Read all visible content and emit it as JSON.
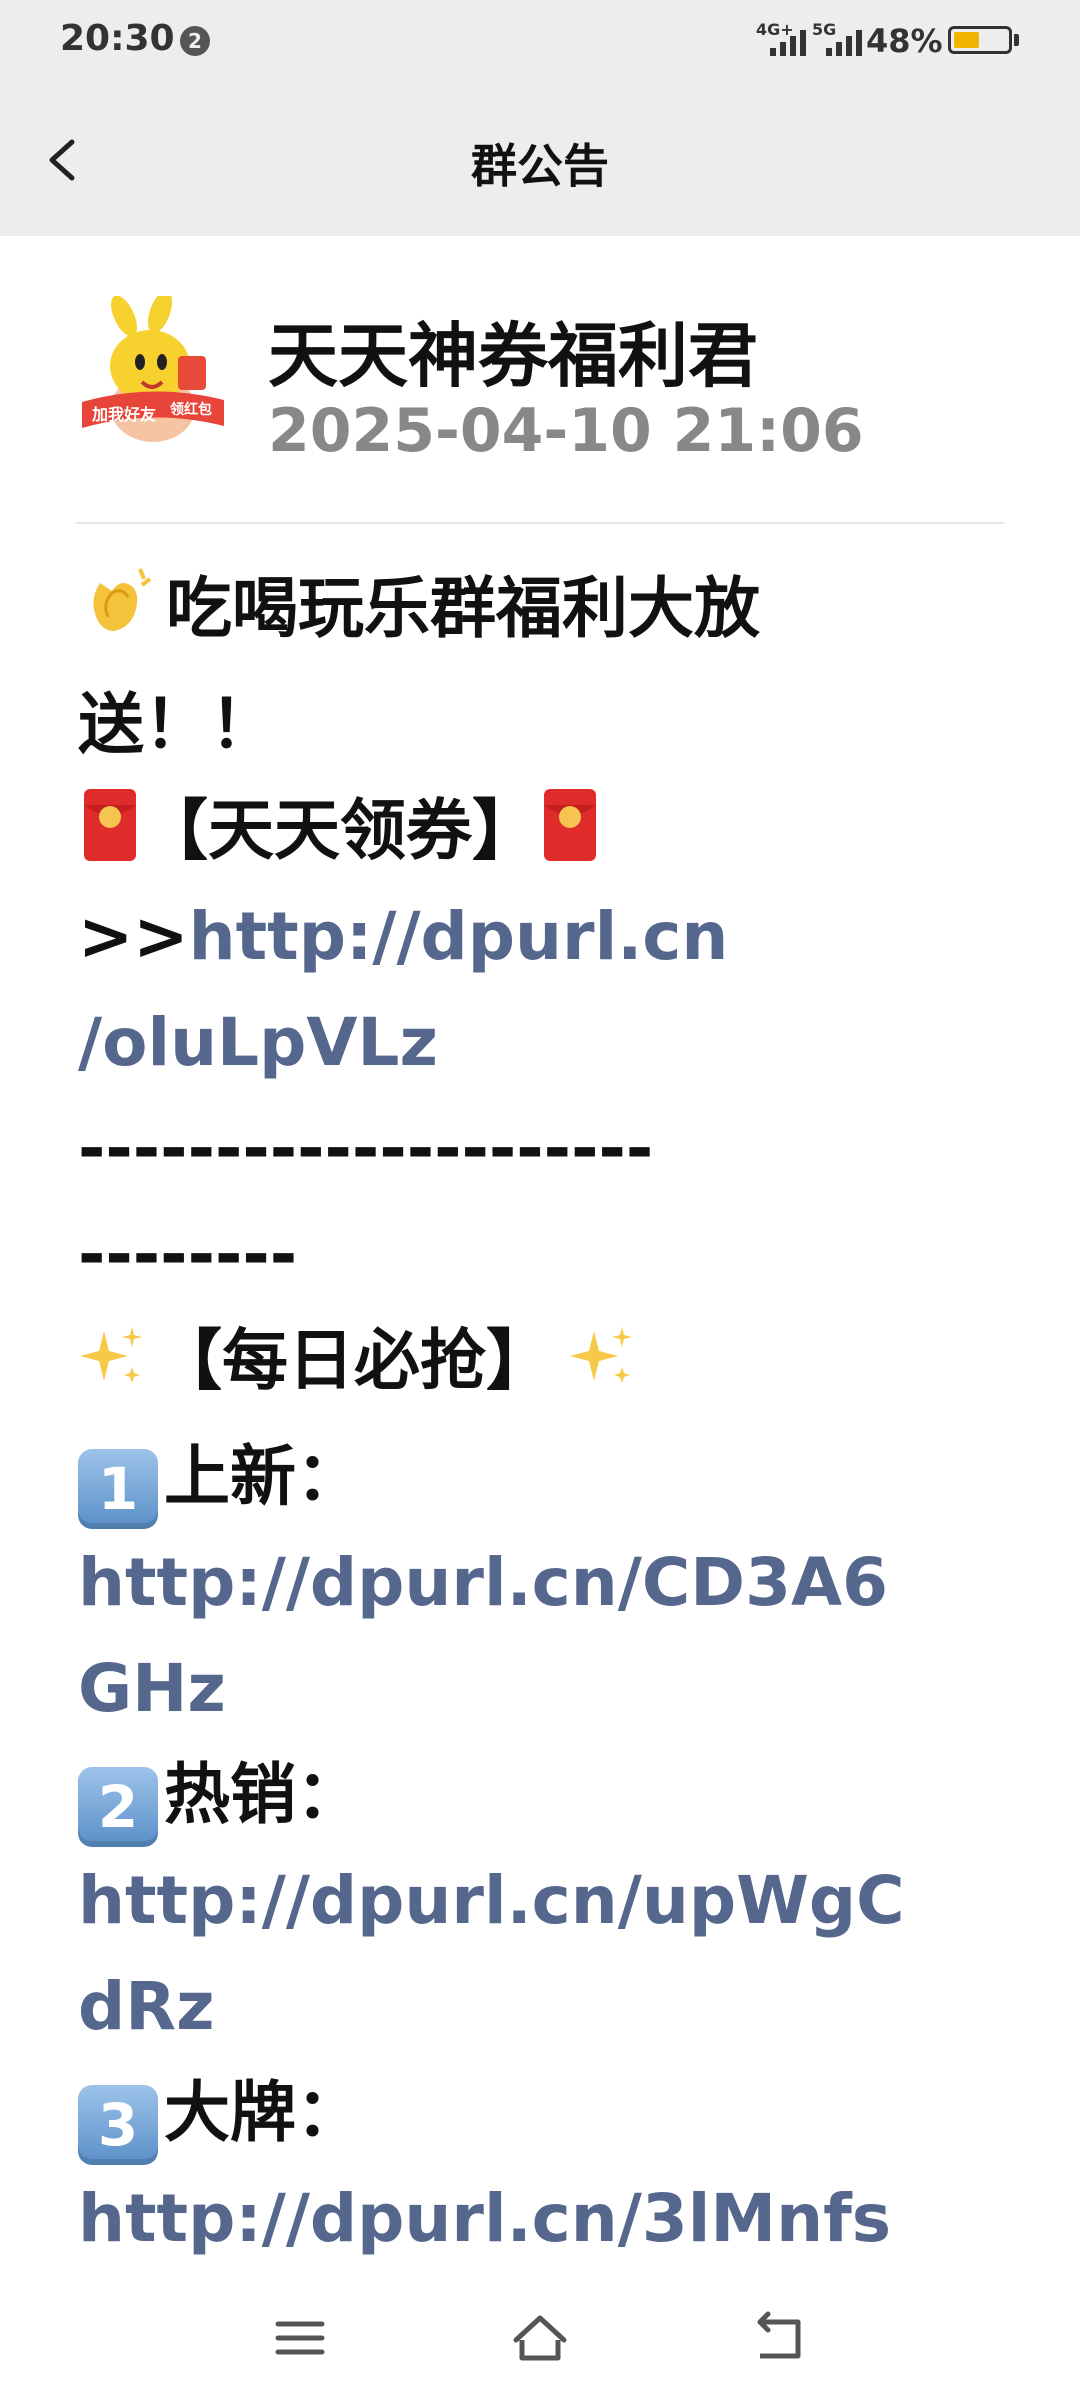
{
  "status_bar": {
    "time": "20:30",
    "notification_count": "2",
    "signal_1_label": "4G+",
    "signal_2_label": "5G",
    "battery_percent": "48%",
    "battery_level": 0.48,
    "battery_color": "#f2b400"
  },
  "navbar": {
    "back_icon": "chevron-left-icon",
    "title": "群公告"
  },
  "announcement": {
    "avatar_icon": "yellow-mascot-avatar",
    "author": "天天神券福利君",
    "timestamp": "2025-04-10 21:06",
    "lines": {
      "headline_1": "吃喝玩乐群福利大放",
      "headline_2": "送！！",
      "coupon_heading": "【天天领券】",
      "coupon_prefix": ">>",
      "coupon_link_1": "http://dpurl.cn",
      "coupon_link_2": "/oluLpVLz",
      "separator_1": "---------------------",
      "separator_2": "--------",
      "daily_heading": "【每日必抢】",
      "item1_num": "1",
      "item1_label": "上新：",
      "item1_link_1": "http://dpurl.cn/CD3A6",
      "item1_link_2": "GHz",
      "item2_num": "2",
      "item2_label": "热销：",
      "item2_link_1": "http://dpurl.cn/upWgC",
      "item2_link_2": "dRz",
      "item3_num": "3",
      "item3_label": "大牌：",
      "item3_link_1": "http://dpurl.cn/3lMnfs"
    },
    "link_color": "#56678e"
  },
  "bottom_nav": {
    "menu_icon": "menu-icon",
    "home_icon": "home-icon",
    "back_icon": "back-icon"
  }
}
